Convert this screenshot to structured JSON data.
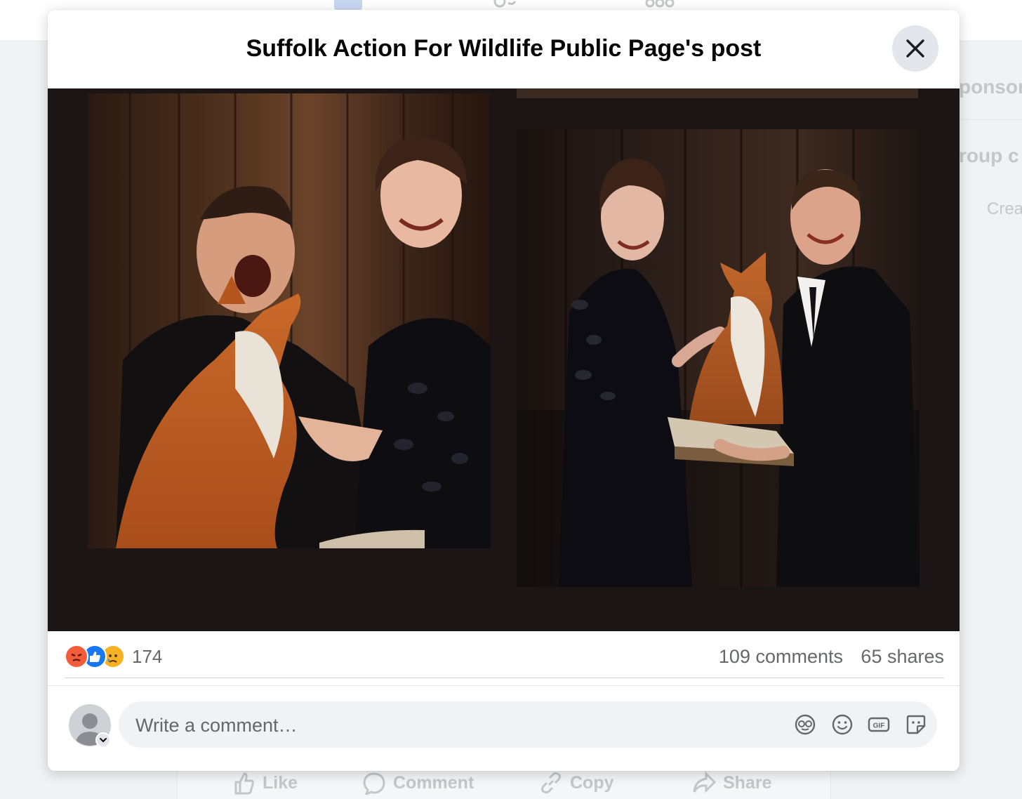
{
  "background": {
    "right_sidebar": {
      "sponsored_fragment": "ponsor",
      "group_fragment": "roup c",
      "create_fragment": "Crea"
    },
    "post_actions": [
      {
        "label": "Like",
        "icon": "like-icon"
      },
      {
        "label": "Comment",
        "icon": "comment-icon"
      },
      {
        "label": "Copy",
        "icon": "link-icon"
      },
      {
        "label": "Share",
        "icon": "share-icon"
      }
    ]
  },
  "modal": {
    "title": "Suffolk Action For Wildlife Public Page's post",
    "close_icon": "close-icon"
  },
  "stats": {
    "reactions": [
      "angry",
      "like",
      "sad"
    ],
    "reaction_count": "174",
    "comments": "109 comments",
    "shares": "65 shares"
  },
  "composer": {
    "placeholder": "Write a comment…",
    "icons": [
      "avatar-sticker-icon",
      "emoji-icon",
      "gif-icon",
      "sticker-icon"
    ]
  },
  "colors": {
    "media_bg": "#1c1516",
    "like_blue": "#1877f2",
    "angry_orange": "#f25c3a",
    "sad_yellow": "#f7b125",
    "secondary_text": "#65676b"
  }
}
